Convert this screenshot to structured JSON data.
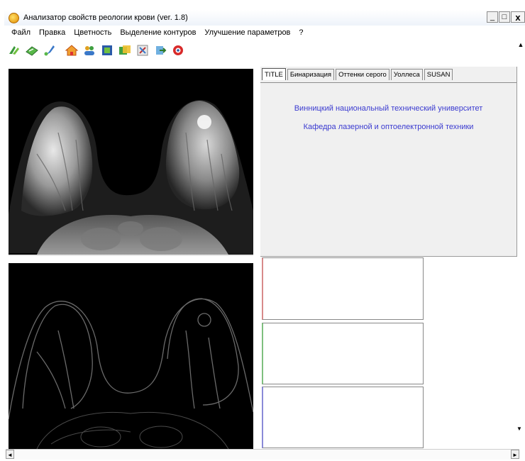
{
  "window": {
    "title": "Анализатор свойств реологии крови (ver. 1.8)",
    "buttons": {
      "minimize": "_",
      "maximize": "□",
      "close": "x"
    }
  },
  "menu": {
    "items": [
      "Файл",
      "Правка",
      "Цветность",
      "Выделение контуров",
      "Улучшение параметров",
      "?"
    ]
  },
  "toolbar": {
    "icons": [
      "open-icon",
      "save-icon",
      "brush-icon",
      "home-icon",
      "users-icon",
      "book-icon",
      "copy-icon",
      "tools-icon",
      "export-icon",
      "help-icon"
    ]
  },
  "tabs": {
    "labels": [
      "TITLE",
      "Бинаризация",
      "Оттенки серого",
      "Уоллеса",
      "SUSAN"
    ],
    "active": "TITLE"
  },
  "title_tab": {
    "line1": "Винницкий национальный технический университет",
    "line2": "Кафедра лазерной и оптоелектронной техники"
  },
  "scroll": {
    "up": "▲",
    "down": "▼",
    "left": "◄",
    "right": "►"
  },
  "colors": {
    "link_text": "#3b3bd0",
    "graph_red": "#d88a8a",
    "graph_green": "#7fbf7f",
    "graph_blue": "#8a8ad8"
  }
}
